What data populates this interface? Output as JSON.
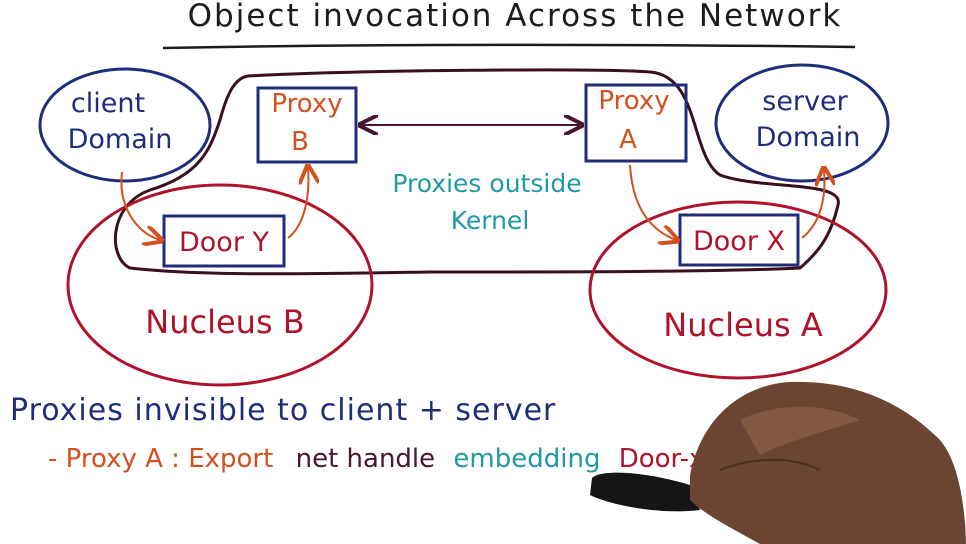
{
  "title": "Object invocation Across the Network",
  "domains": {
    "client": {
      "line1": "client",
      "line2": "Domain"
    },
    "server": {
      "line1": "server",
      "line2": "Domain"
    }
  },
  "proxies": {
    "b": {
      "line1": "Proxy",
      "line2": "B"
    },
    "a": {
      "line1": "Proxy",
      "line2": "A"
    }
  },
  "doors": {
    "y": "Door Y",
    "x": "Door X"
  },
  "nuclei": {
    "b": "Nucleus B",
    "a": "Nucleus A"
  },
  "kernel_note": {
    "line1": "Proxies outside",
    "line2": "Kernel"
  },
  "notes": {
    "line1": "Proxies invisible to client + server",
    "line2_prefix": "- Proxy A : Export",
    "line2_mid": "net handle",
    "line2_embed": "embedding",
    "line2_end": "Door-x"
  },
  "colors": {
    "ink_navy": "#1f2d7a",
    "ink_red": "#b0122a",
    "ink_orange": "#d4501e",
    "ink_teal": "#1f9aa6",
    "ink_maroon": "#4a1530",
    "ink_dark": "#3a0f1e"
  }
}
